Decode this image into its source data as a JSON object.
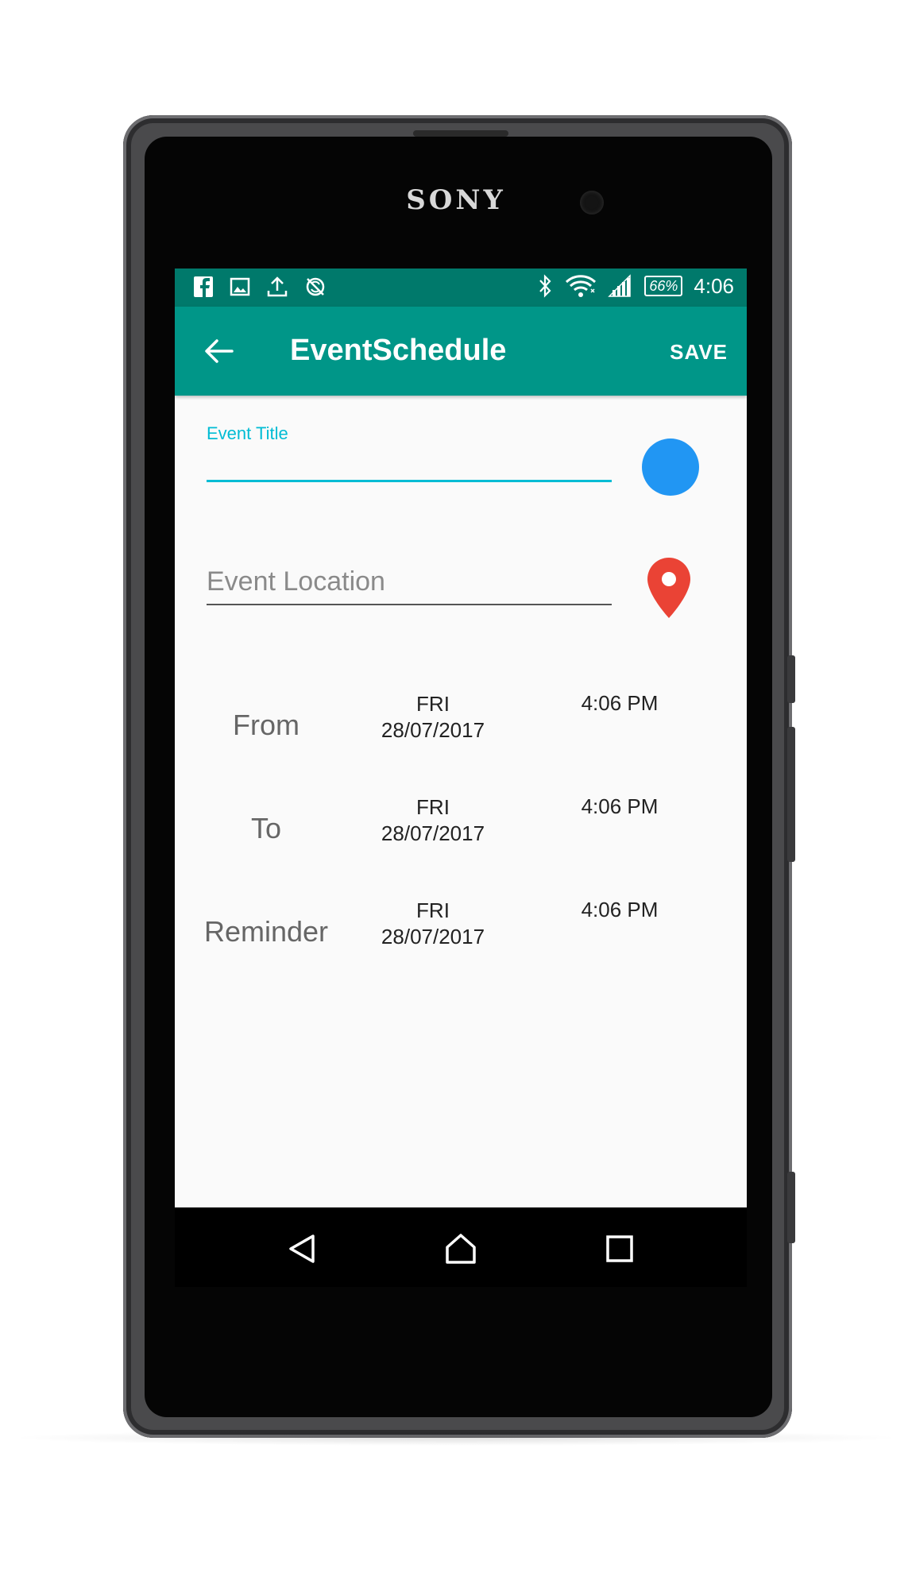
{
  "device": {
    "brand": "SONY"
  },
  "status_bar": {
    "left_icons": [
      "facebook-icon",
      "image-icon",
      "upload-icon",
      "sync-off-icon"
    ],
    "right_icons": [
      "bluetooth-icon",
      "wifi-icon",
      "signal-icon"
    ],
    "battery": "66%",
    "time": "4:06",
    "color": "#00796b"
  },
  "app_bar": {
    "title": "EventSchedule",
    "save_label": "SAVE",
    "color": "#009688"
  },
  "form": {
    "title_label": "Event Title",
    "title_value": "",
    "accent_color": "#00bcd4",
    "event_color": "#2196f3",
    "location_placeholder": "Event Location",
    "location_value": "",
    "pin_color": "#ea4335"
  },
  "schedule": [
    {
      "label": "From",
      "day": "FRI",
      "date": "28/07/2017",
      "time": "4:06 PM"
    },
    {
      "label": "To",
      "day": "FRI",
      "date": "28/07/2017",
      "time": "4:06 PM"
    },
    {
      "label": "Reminder",
      "day": "FRI",
      "date": "28/07/2017",
      "time": "4:06 PM"
    }
  ],
  "nav_bar": [
    "back-icon",
    "home-icon",
    "recents-icon"
  ]
}
